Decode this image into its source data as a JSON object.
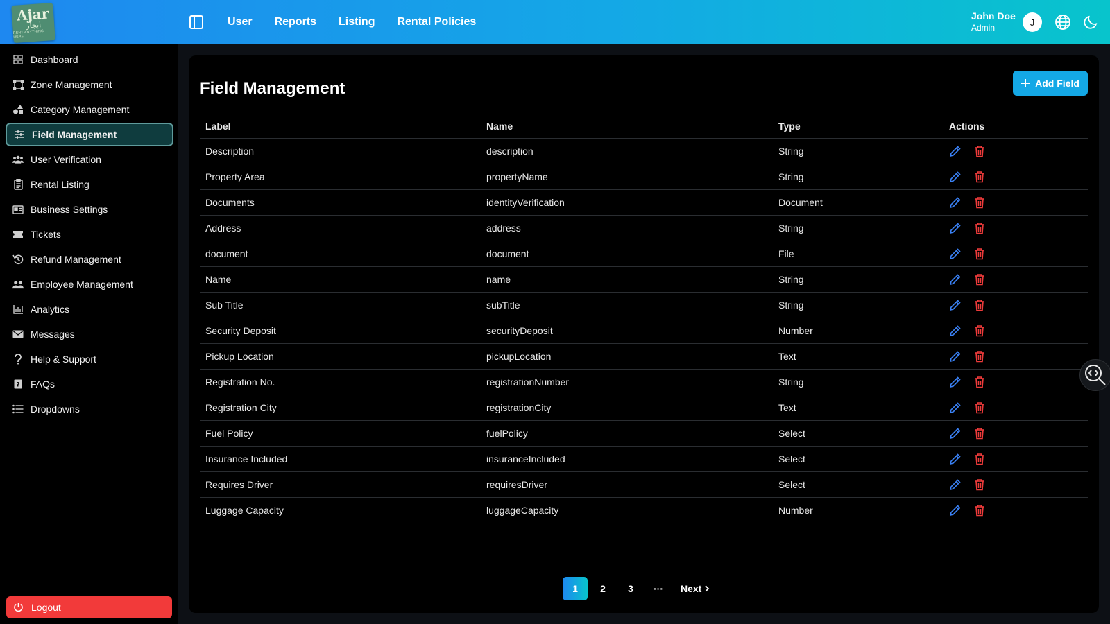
{
  "logo": {
    "text": "Ajar",
    "subtext": "ايجار",
    "tagline": "RENT ANYTHING HERE"
  },
  "topnav": {
    "items": [
      "User",
      "Reports",
      "Listing",
      "Rental Policies"
    ]
  },
  "user": {
    "name": "John Doe",
    "role": "Admin",
    "initial": "J"
  },
  "sidebar": {
    "items": [
      {
        "label": "Dashboard",
        "icon": "grid-icon"
      },
      {
        "label": "Zone Management",
        "icon": "zone-icon"
      },
      {
        "label": "Category Management",
        "icon": "shapes-icon"
      },
      {
        "label": "Field Management",
        "icon": "sliders-icon",
        "active": true
      },
      {
        "label": "User Verification",
        "icon": "users-icon"
      },
      {
        "label": "Rental Listing",
        "icon": "clipboard-icon"
      },
      {
        "label": "Business Settings",
        "icon": "id-card-icon"
      },
      {
        "label": "Tickets",
        "icon": "ticket-icon"
      },
      {
        "label": "Refund Management",
        "icon": "refund-icon"
      },
      {
        "label": "Employee Management",
        "icon": "team-icon"
      },
      {
        "label": "Analytics",
        "icon": "chart-icon"
      },
      {
        "label": "Messages",
        "icon": "mail-icon"
      },
      {
        "label": "Help & Support",
        "icon": "question-icon"
      },
      {
        "label": "FAQs",
        "icon": "faq-icon"
      },
      {
        "label": "Dropdowns",
        "icon": "list-icon"
      }
    ],
    "logout": "Logout"
  },
  "main": {
    "title": "Field Management",
    "add_button": "Add Field",
    "columns": [
      "Label",
      "Name",
      "Type",
      "Actions"
    ],
    "rows": [
      {
        "label": "Description",
        "name": "description",
        "type": "String"
      },
      {
        "label": "Property Area",
        "name": "propertyName",
        "type": "String"
      },
      {
        "label": "Documents",
        "name": "identityVerification",
        "type": "Document"
      },
      {
        "label": "Address",
        "name": "address",
        "type": "String"
      },
      {
        "label": "document",
        "name": "document",
        "type": "File"
      },
      {
        "label": "Name",
        "name": "name",
        "type": "String"
      },
      {
        "label": "Sub Title",
        "name": "subTitle",
        "type": "String"
      },
      {
        "label": "Security Deposit",
        "name": "securityDeposit",
        "type": "Number"
      },
      {
        "label": "Pickup Location",
        "name": "pickupLocation",
        "type": "Text"
      },
      {
        "label": "Registration No.",
        "name": "registrationNumber",
        "type": "String"
      },
      {
        "label": "Registration City",
        "name": "registrationCity",
        "type": "Text"
      },
      {
        "label": "Fuel Policy",
        "name": "fuelPolicy",
        "type": "Select"
      },
      {
        "label": "Insurance Included",
        "name": "insuranceIncluded",
        "type": "Select"
      },
      {
        "label": "Requires Driver",
        "name": "requiresDriver",
        "type": "Select"
      },
      {
        "label": "Luggage Capacity",
        "name": "luggageCapacity",
        "type": "Number"
      }
    ],
    "pagination": {
      "pages": [
        "1",
        "2",
        "3"
      ],
      "current": "1",
      "ellipsis": "···",
      "next": "Next"
    }
  },
  "colors": {
    "accent": "#14a8e6",
    "edit": "#3b82f6",
    "delete": "#ef3b3b",
    "logout": "#f23a3a"
  }
}
